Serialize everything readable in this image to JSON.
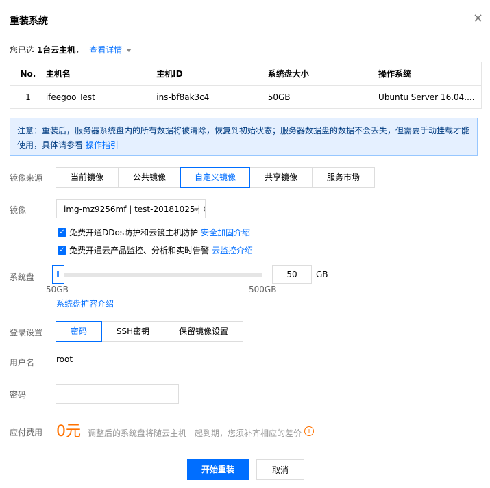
{
  "dialog": {
    "title": "重装系统",
    "close_icon": "×"
  },
  "selection": {
    "prefix": "您已选 ",
    "count": "1台云主机",
    "suffix": "，",
    "details_link": "查看详情"
  },
  "hosts_table": {
    "headers": [
      "No.",
      "主机名",
      "主机ID",
      "系统盘大小",
      "操作系统"
    ],
    "rows": [
      [
        "1",
        "ifeegoo Test",
        "ins-bf8ak3c4",
        "50GB",
        "Ubuntu Server 16.04...."
      ]
    ]
  },
  "notice": {
    "text": "注意：重装后，服务器系统盘内的所有数据将被清除，恢复到初始状态；服务器数据盘的数据不会丢失，但需要手动挂载才能使用，具体请参看 ",
    "link": "操作指引"
  },
  "image_source": {
    "label": "镜像来源",
    "tabs": [
      "当前镜像",
      "公共镜像",
      "自定义镜像",
      "共享镜像",
      "服务市场"
    ],
    "active_index": 2
  },
  "image": {
    "label": "镜像",
    "selected": "img-mz9256mf | test-20181025 | C",
    "checks": [
      {
        "text": "免费开通DDos防护和云镜主机防护",
        "link": "安全加固介绍",
        "checked": true
      },
      {
        "text": "免费开通云产品监控、分析和实时告警",
        "link": "云监控介绍",
        "checked": true
      }
    ]
  },
  "system_disk": {
    "label": "系统盘",
    "value": "50",
    "unit": "GB",
    "min_label": "50GB",
    "max_label": "500GB",
    "level": 0.0,
    "expand_link": "系统盘扩容介绍"
  },
  "login": {
    "label": "登录设置",
    "tabs": [
      "密码",
      "SSH密钥",
      "保留镜像设置"
    ],
    "active_index": 0
  },
  "username": {
    "label": "用户名",
    "value": "root"
  },
  "password": {
    "label": "密码",
    "value": ""
  },
  "fee": {
    "label": "应付费用",
    "amount": "0元",
    "note": "调整后的系统盘将随云主机一起到期，您须补齐相应的差价",
    "info_icon": "i"
  },
  "actions": {
    "confirm": "开始重装",
    "cancel": "取消"
  },
  "colors": {
    "accent": "#006eff",
    "fee": "#ff7200",
    "notice_bg": "#e5f0ff"
  }
}
